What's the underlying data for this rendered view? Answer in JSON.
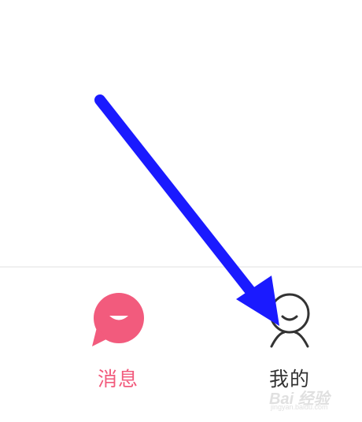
{
  "tabbar": {
    "tabs": [
      {
        "label": "消息",
        "icon": "message-bubble-icon",
        "color": "#f25b7d",
        "active": true
      },
      {
        "label": "我的",
        "icon": "profile-face-icon",
        "color": "#333333",
        "active": false
      }
    ]
  },
  "annotation": {
    "arrow_color": "#1a1aff",
    "icon": "arrow-pointer-icon"
  },
  "watermark": {
    "logo": "Bai 经验",
    "sub": "jingyan.baidu.com"
  },
  "colors": {
    "background": "#ffffff",
    "divider": "#f0f0f0",
    "accent": "#f25b7d"
  }
}
